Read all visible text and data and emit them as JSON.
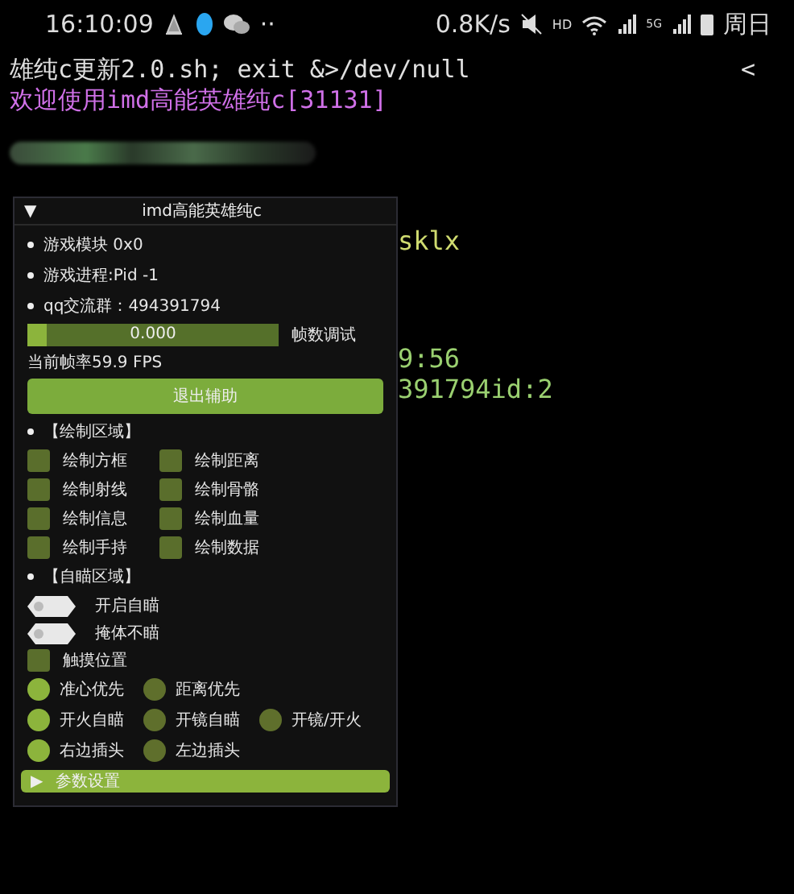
{
  "status_bar": {
    "time": "16:10:09",
    "more": "··",
    "speed": "0.8K/s",
    "hd": "HD",
    "network": "5G",
    "day": "周日"
  },
  "terminal": {
    "lines": [
      {
        "text": "雄纯c更新2.0.sh; exit &>/dev/null",
        "kind": "plain"
      },
      {
        "text": "欢迎使用imd高能英雄纯c[31131]",
        "kind": "accent"
      }
    ],
    "back": "<",
    "side_texts": [
      {
        "text": "sklx",
        "kind": "yellow"
      },
      {
        "text": "9:56",
        "kind": "green"
      },
      {
        "text": "391794id:2",
        "kind": "green"
      }
    ]
  },
  "panel": {
    "collapse": "▼",
    "title": "imd高能英雄纯c",
    "info": [
      "游戏模块 0x0",
      "游戏进程:Pid -1",
      "qq交流群：494391794"
    ],
    "slider": {
      "value": "0.000",
      "level": 0.08,
      "label": "帧数调试"
    },
    "fps": "当前帧率59.9 FPS",
    "exit_button": "退出辅助",
    "draw_section": "【绘制区域】",
    "draw_options": [
      {
        "label": "绘制方框",
        "checked": false
      },
      {
        "label": "绘制距离",
        "checked": false
      },
      {
        "label": "绘制射线",
        "checked": false
      },
      {
        "label": "绘制骨骼",
        "checked": false
      },
      {
        "label": "绘制信息",
        "checked": false
      },
      {
        "label": "绘制血量",
        "checked": false
      },
      {
        "label": "绘制手持",
        "checked": false
      },
      {
        "label": "绘制数据",
        "checked": false
      }
    ],
    "aim_section": "【自瞄区域】",
    "toggles": [
      {
        "label": "开启自瞄",
        "on": false
      },
      {
        "label": "掩体不瞄",
        "on": false
      }
    ],
    "touch_option": {
      "label": "触摸位置",
      "checked": false
    },
    "radio_rows": [
      [
        {
          "label": "准心优先",
          "selected": true
        },
        {
          "label": "距离优先",
          "selected": false
        }
      ],
      [
        {
          "label": "开火自瞄",
          "selected": true
        },
        {
          "label": "开镜自瞄",
          "selected": false
        },
        {
          "label": "开镜/开火",
          "selected": false
        }
      ],
      [
        {
          "label": "右边插头",
          "selected": true
        },
        {
          "label": "左边插头",
          "selected": false
        }
      ]
    ],
    "footer": {
      "arrow": "▶",
      "label": "参数设置"
    }
  }
}
